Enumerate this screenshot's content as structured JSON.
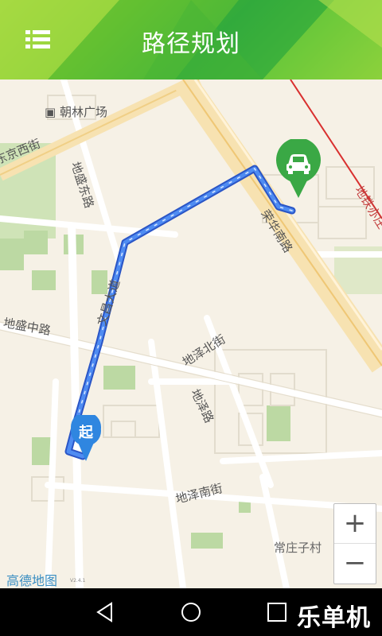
{
  "header": {
    "title": "路径规划",
    "menu_icon": "list-menu-icon"
  },
  "map": {
    "labels": {
      "chaolin_plaza": "朝林广场",
      "jingxi_road": "东京西街",
      "disheng_east": "地盛东路",
      "kangrui_south": "荣华南路",
      "wenchang_ave": "文昌大道",
      "disheng_mid": "地盛中路",
      "dize_north": "地泽北街",
      "dize_road": "地泽路",
      "dize_south": "地泽南街",
      "changzhuang": "常庄子村",
      "metro_line": "地铁亦庄"
    },
    "start_marker": "起",
    "car_marker_icon": "car-icon",
    "route_color": "#3a6fe0"
  },
  "zoom": {
    "plus": "+",
    "minus": "−"
  },
  "brand": {
    "logo_text": "高德地图",
    "version": "V2.4.1"
  },
  "watermark": "乐单机",
  "nav": {
    "back_icon": "back-icon",
    "home_icon": "home-icon",
    "recent_icon": "recent-apps-icon"
  }
}
